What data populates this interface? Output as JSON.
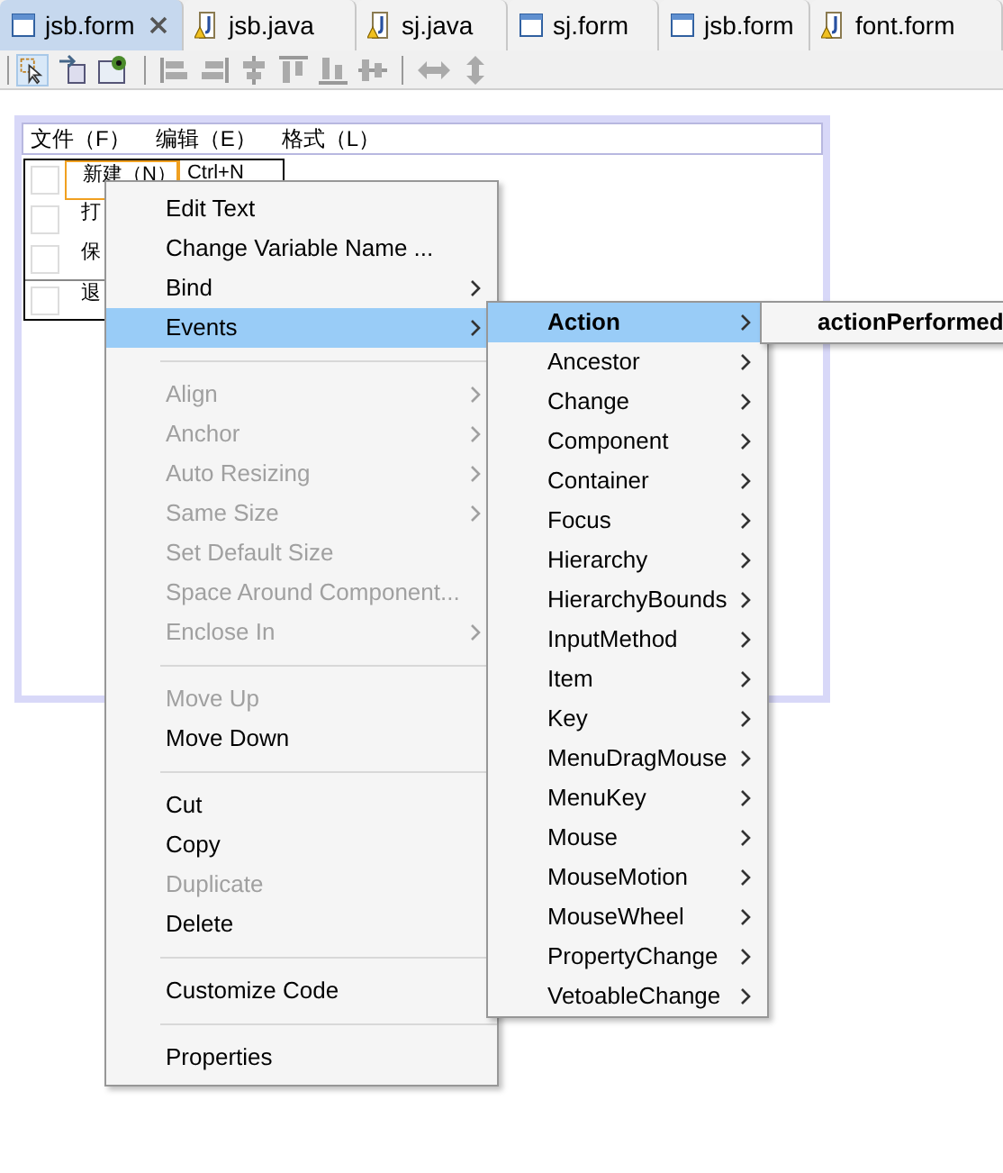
{
  "tabs": [
    {
      "label": "jsb.form",
      "kind": "form",
      "selected": true,
      "closable": true
    },
    {
      "label": "jsb.java",
      "kind": "java",
      "selected": false,
      "closable": false
    },
    {
      "label": "sj.java",
      "kind": "java",
      "selected": false,
      "closable": false
    },
    {
      "label": "sj.form",
      "kind": "form",
      "selected": false,
      "closable": false
    },
    {
      "label": "jsb.form",
      "kind": "form",
      "selected": false,
      "closable": false
    },
    {
      "label": "font.form",
      "kind": "java",
      "selected": false,
      "closable": false
    }
  ],
  "form": {
    "menu_bar": [
      "文件（F）",
      "编辑（E）",
      "格式（L）"
    ],
    "menu_items": [
      {
        "label": "新建（N）",
        "shortcut": "Ctrl+N",
        "selected": true,
        "checked": false
      },
      {
        "label": "打",
        "selected": false,
        "checked": false
      },
      {
        "label": "保",
        "selected": false,
        "checked": false
      },
      {
        "label": "退",
        "selected": false,
        "checked": false
      }
    ]
  },
  "context_menu": [
    {
      "kind": "item",
      "label": "Edit Text",
      "disabled": false,
      "submenu": false,
      "selected": false
    },
    {
      "kind": "item",
      "label": "Change Variable Name ...",
      "disabled": false,
      "submenu": false,
      "selected": false
    },
    {
      "kind": "item",
      "label": "Bind",
      "disabled": false,
      "submenu": true,
      "selected": false
    },
    {
      "kind": "item",
      "label": "Events",
      "disabled": false,
      "submenu": true,
      "selected": true
    },
    {
      "kind": "separator"
    },
    {
      "kind": "item",
      "label": "Align",
      "disabled": true,
      "submenu": true,
      "selected": false
    },
    {
      "kind": "item",
      "label": "Anchor",
      "disabled": true,
      "submenu": true,
      "selected": false
    },
    {
      "kind": "item",
      "label": "Auto Resizing",
      "disabled": true,
      "submenu": true,
      "selected": false
    },
    {
      "kind": "item",
      "label": "Same Size",
      "disabled": true,
      "submenu": true,
      "selected": false
    },
    {
      "kind": "item",
      "label": "Set Default Size",
      "disabled": true,
      "submenu": false,
      "selected": false
    },
    {
      "kind": "item",
      "label": "Space Around Component...",
      "disabled": true,
      "submenu": false,
      "selected": false
    },
    {
      "kind": "item",
      "label": "Enclose In",
      "disabled": true,
      "submenu": true,
      "selected": false
    },
    {
      "kind": "separator"
    },
    {
      "kind": "item",
      "label": "Move Up",
      "disabled": true,
      "submenu": false,
      "selected": false
    },
    {
      "kind": "item",
      "label": "Move Down",
      "disabled": false,
      "submenu": false,
      "selected": false
    },
    {
      "kind": "separator"
    },
    {
      "kind": "item",
      "label": "Cut",
      "disabled": false,
      "submenu": false,
      "selected": false
    },
    {
      "kind": "item",
      "label": "Copy",
      "disabled": false,
      "submenu": false,
      "selected": false
    },
    {
      "kind": "item",
      "label": "Duplicate",
      "disabled": true,
      "submenu": false,
      "selected": false
    },
    {
      "kind": "item",
      "label": "Delete",
      "disabled": false,
      "submenu": false,
      "selected": false
    },
    {
      "kind": "separator"
    },
    {
      "kind": "item",
      "label": "Customize Code",
      "disabled": false,
      "submenu": false,
      "selected": false
    },
    {
      "kind": "separator"
    },
    {
      "kind": "item",
      "label": "Properties",
      "disabled": false,
      "submenu": false,
      "selected": false
    }
  ],
  "events_menu": [
    {
      "label": "Action",
      "selected": true
    },
    {
      "label": "Ancestor",
      "selected": false
    },
    {
      "label": "Change",
      "selected": false
    },
    {
      "label": "Component",
      "selected": false
    },
    {
      "label": "Container",
      "selected": false
    },
    {
      "label": "Focus",
      "selected": false
    },
    {
      "label": "Hierarchy",
      "selected": false
    },
    {
      "label": "HierarchyBounds",
      "selected": false
    },
    {
      "label": "InputMethod",
      "selected": false
    },
    {
      "label": "Item",
      "selected": false
    },
    {
      "label": "Key",
      "selected": false
    },
    {
      "label": "MenuDragMouse",
      "selected": false
    },
    {
      "label": "MenuKey",
      "selected": false
    },
    {
      "label": "Mouse",
      "selected": false
    },
    {
      "label": "MouseMotion",
      "selected": false
    },
    {
      "label": "MouseWheel",
      "selected": false
    },
    {
      "label": "PropertyChange",
      "selected": false
    },
    {
      "label": "VetoableChange",
      "selected": false
    }
  ],
  "action_menu": [
    "actionPerformed"
  ]
}
